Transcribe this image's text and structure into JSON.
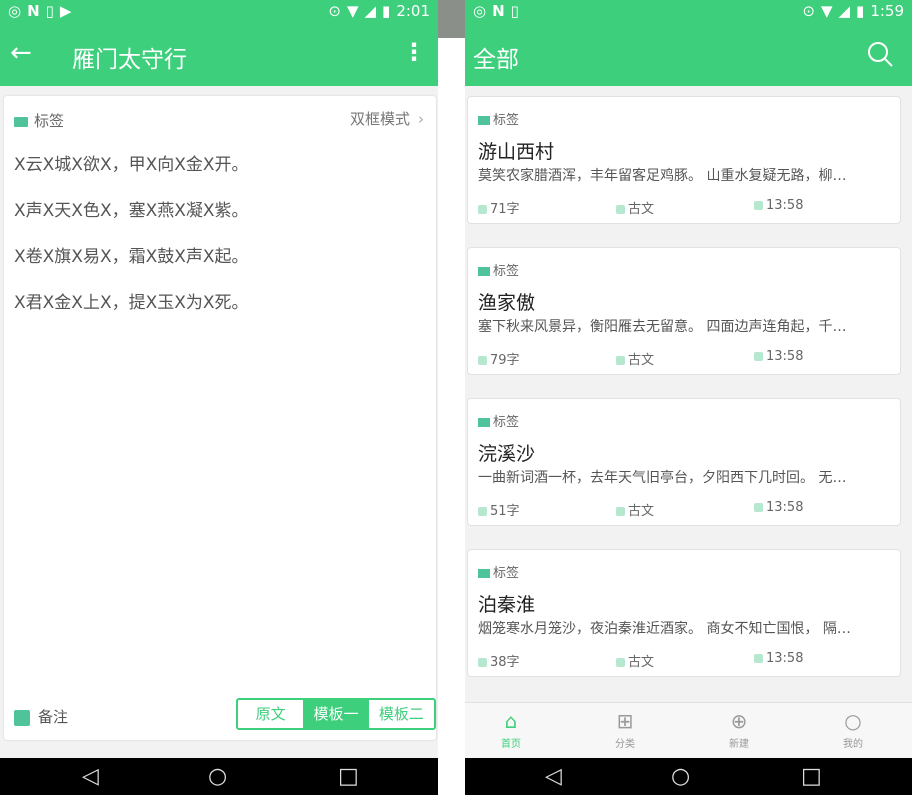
{
  "left": {
    "status_time": "2:01",
    "title": "雁门太守行",
    "tag_label": "标签",
    "mode_label": "双框模式",
    "lines": [
      "X云X城X欲X，甲X向X金X开。",
      "X声X天X色X，塞X燕X凝X紫。",
      "X卷X旗X易X，霜X鼓X声X起。",
      "X君X金X上X，提X玉X为X死。"
    ],
    "note_label": "备注",
    "segments": [
      "原文",
      "模板一",
      "模板二"
    ],
    "active_segment": "模板一"
  },
  "right": {
    "status_time": "1:59",
    "title": "全部",
    "cards": [
      {
        "tag": "标签",
        "title": "游山西村",
        "excerpt": "莫笑农家腊酒浑，丰年留客足鸡豚。 山重水复疑无路，柳…",
        "words": "71字",
        "category": "古文",
        "time": "13:58"
      },
      {
        "tag": "标签",
        "title": "渔家傲",
        "excerpt": "塞下秋来风景异，衡阳雁去无留意。 四面边声连角起，千…",
        "words": "79字",
        "category": "古文",
        "time": "13:58"
      },
      {
        "tag": "标签",
        "title": "浣溪沙",
        "excerpt": "一曲新词酒一杯，去年天气旧亭台，夕阳西下几时回。 无…",
        "words": "51字",
        "category": "古文",
        "time": "13:58"
      },
      {
        "tag": "标签",
        "title": "泊秦淮",
        "excerpt": "烟笼寒水月笼沙，夜泊秦淮近酒家。 商女不知亡国恨， 隔…",
        "words": "38字",
        "category": "古文",
        "time": "13:58"
      }
    ],
    "tabs": [
      "首页",
      "分类",
      "新建",
      "我的"
    ],
    "active_tab": "首页"
  },
  "colors": {
    "accent": "#3ecf7c",
    "tag_icon": "#4fc49a"
  }
}
